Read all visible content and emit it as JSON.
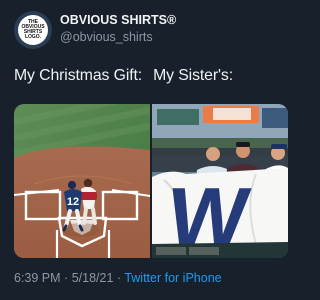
{
  "account": {
    "display_name": "OBVIOUS SHIRTS®",
    "handle": "@obvious_shirts",
    "avatar_text": [
      "THE",
      "OBVIOUS",
      "SHIRTS",
      "LOGO."
    ]
  },
  "tweet": {
    "text_left": "My Christmas Gift:",
    "text_right": "My Sister's:"
  },
  "media": {
    "left_photo": {
      "player_number": "12"
    },
    "right_photo": {
      "flag_letter": "W"
    }
  },
  "footer": {
    "time": "6:39 PM",
    "separator": "·",
    "date": "5/18/21",
    "separator2": "·",
    "source": "Twitter for iPhone"
  },
  "colors": {
    "background": "#17202b",
    "link": "#1d9bf0",
    "muted_text": "#8b98a5"
  }
}
